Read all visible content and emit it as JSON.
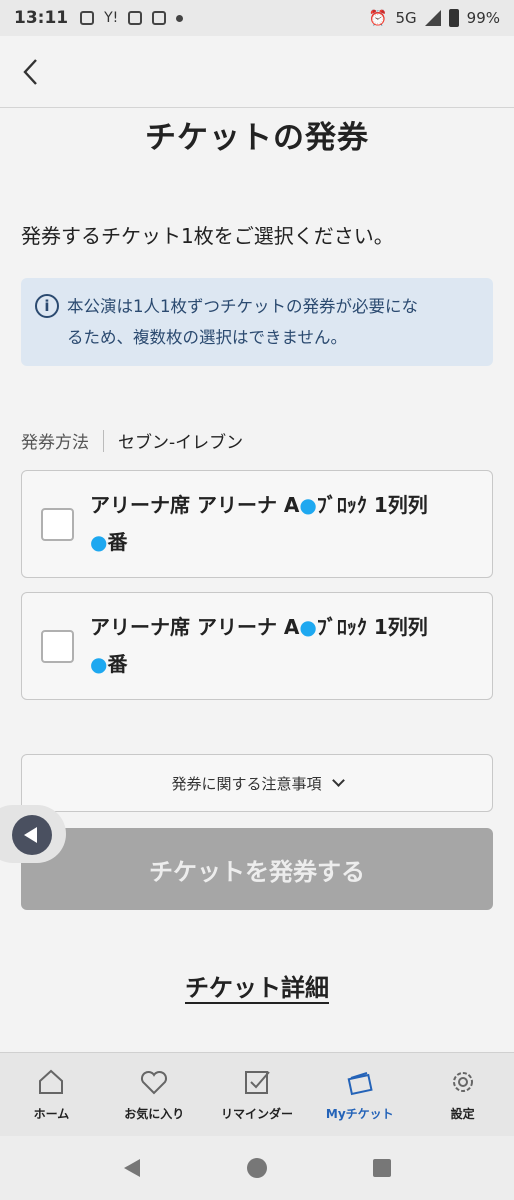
{
  "status_bar": {
    "time": "13:11",
    "network": "5G",
    "battery": "99%"
  },
  "page": {
    "title": "チケットの発券",
    "instruction": "発券するチケット1枚をご選択ください。",
    "info_line1": "本公演は1人1枚ずつチケットの発券が必要にな",
    "info_line2": "るため、複数枚の選択はできません。"
  },
  "method": {
    "label": "発券方法",
    "value": "セブン-イレブン"
  },
  "tickets": [
    {
      "line1": "アリーナ席 アリーナ A",
      "block": "ﾌﾞﾛｯｸ 1列列",
      "line2": "番"
    },
    {
      "line1": "アリーナ席 アリーナ A",
      "block": "ﾌﾞﾛｯｸ 1列列",
      "line2": "番"
    }
  ],
  "notes_button": "発券に関する注意事項",
  "issue_button": "チケットを発券する",
  "detail_link": "チケット詳細",
  "bottom_nav": [
    {
      "label": "ホーム",
      "icon": "home-icon"
    },
    {
      "label": "お気に入り",
      "icon": "heart-icon"
    },
    {
      "label": "リマインダー",
      "icon": "checkbox-icon"
    },
    {
      "label": "Myチケット",
      "icon": "ticket-icon",
      "active": true
    },
    {
      "label": "設定",
      "icon": "gear-icon"
    }
  ],
  "colors": {
    "accent": "#2463b8",
    "info_bg": "#dde7f2",
    "disabled_button": "#a6a6a6"
  }
}
